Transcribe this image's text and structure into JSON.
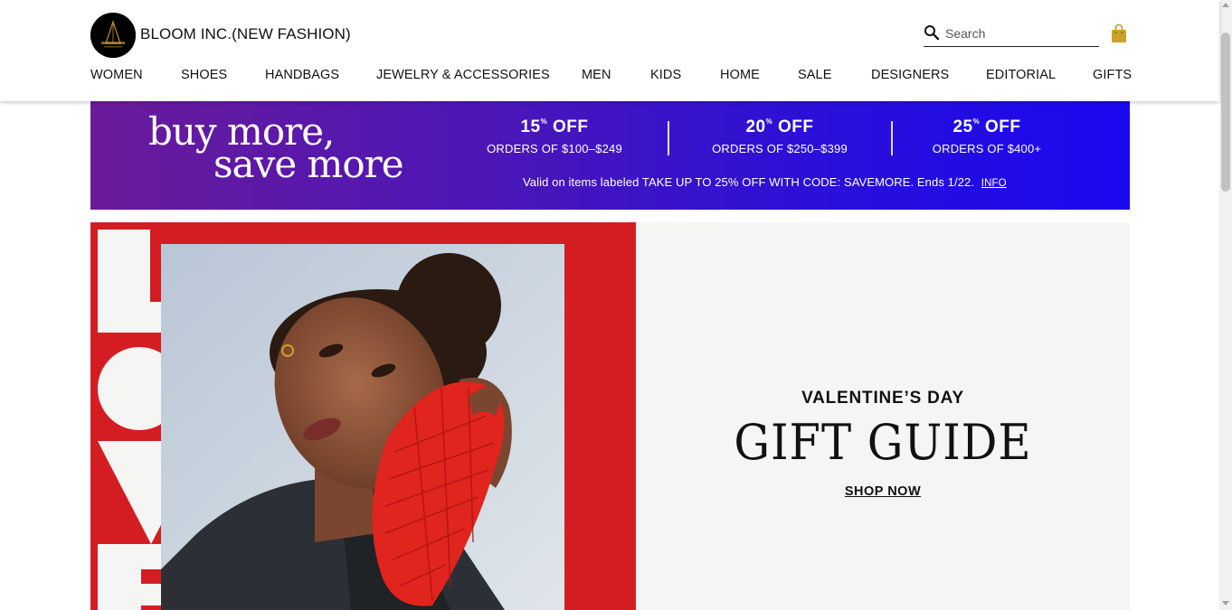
{
  "header": {
    "brand_name": "BLOOM INC.(NEW FASHION)",
    "search": {
      "placeholder": "Search",
      "value": ""
    },
    "icons": {
      "search": "search-icon",
      "bag": "shopping-bag-icon",
      "logo": "brand-logo"
    },
    "bag_color": "#c9a227"
  },
  "nav": {
    "items": [
      {
        "label": "WOMEN"
      },
      {
        "label": "SHOES"
      },
      {
        "label": "HANDBAGS"
      },
      {
        "label": "JEWELRY & ACCESSORIES"
      },
      {
        "label": "MEN"
      },
      {
        "label": "KIDS"
      },
      {
        "label": "HOME"
      },
      {
        "label": "SALE"
      },
      {
        "label": "DESIGNERS"
      },
      {
        "label": "EDITORIAL"
      },
      {
        "label": "GIFTS"
      }
    ]
  },
  "promo": {
    "title_line1": "buy more,",
    "title_line2": "save more",
    "tiers": [
      {
        "pct": "15",
        "pct_sign": "%",
        "off": "OFF",
        "range": "ORDERS OF $100–$249"
      },
      {
        "pct": "20",
        "pct_sign": "%",
        "off": "OFF",
        "range": "ORDERS OF $250–$399"
      },
      {
        "pct": "25",
        "pct_sign": "%",
        "off": "OFF",
        "range": "ORDERS OF $400+"
      }
    ],
    "note": "Valid on items labeled TAKE UP TO 25% OFF WITH CODE: SAVEMORE. Ends 1/22.",
    "info_link": "INFO",
    "gradient_start": "#6a1b9a",
    "gradient_end": "#1a08f0"
  },
  "hero": {
    "kicker": "VALENTINE’S DAY",
    "title": "GIFT GUIDE",
    "cta": "SHOP NOW",
    "left_bg": "#d41d23",
    "right_bg": "#f5f5f3"
  }
}
